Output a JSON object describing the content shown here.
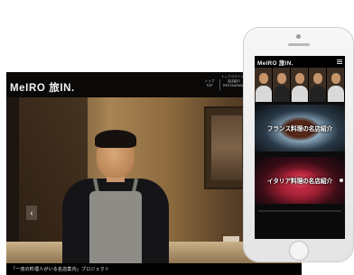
{
  "desktop": {
    "logo": "MeIRO 旅IN.",
    "top_link": "トップ ログイン 会員登録",
    "nav": [
      {
        "line1": "トップ",
        "line2": "TOP"
      },
      {
        "line1": "名店紹介",
        "line2": "RESTAURANT"
      },
      {
        "line1": "料理人",
        "line2": "ALL RESTAURANTS"
      }
    ],
    "caption": "「一流の料理人がいる名店案内」プロジェクト",
    "arrow": "‹"
  },
  "phone": {
    "logo": "MeIRO 旅IN.",
    "banners": [
      {
        "title": "フランス料理の名店紹介"
      },
      {
        "title": "イタリア料理の名店紹介"
      }
    ]
  }
}
